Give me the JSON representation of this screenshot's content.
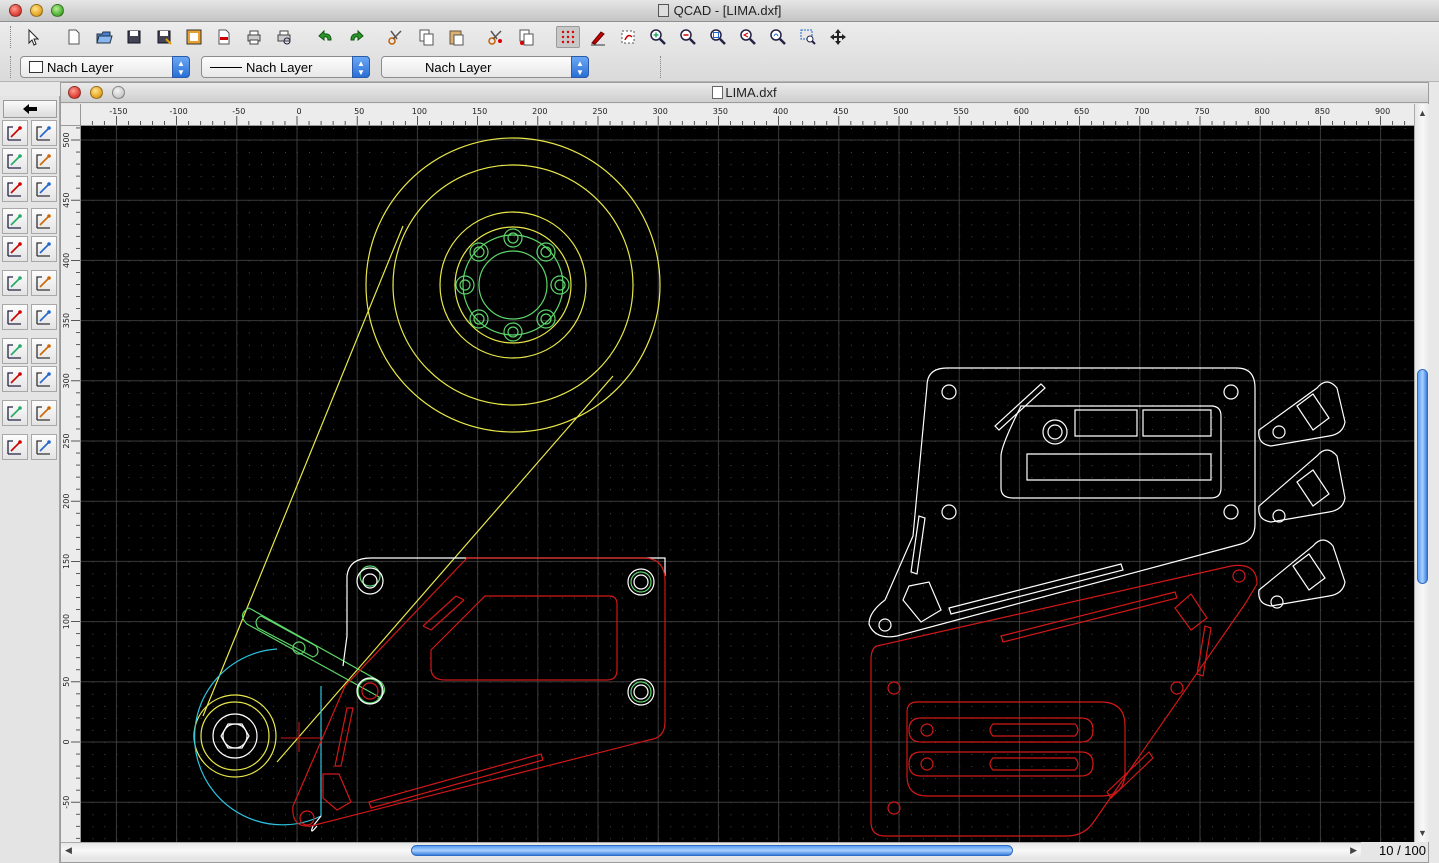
{
  "window": {
    "title": "QCAD - [LIMA.dxf]"
  },
  "toolbar": {
    "buttons": [
      {
        "name": "select-pointer-icon",
        "x": 22
      },
      {
        "name": "new-file-icon",
        "x": 62
      },
      {
        "name": "open-file-icon",
        "x": 92
      },
      {
        "name": "save-file-icon",
        "x": 122
      },
      {
        "name": "save-as-icon",
        "x": 152
      },
      {
        "name": "export-bitmap-icon",
        "x": 182
      },
      {
        "name": "export-pdf-icon",
        "x": 212
      },
      {
        "name": "print-icon",
        "x": 242
      },
      {
        "name": "print-preview-icon",
        "x": 272
      },
      {
        "name": "undo-icon",
        "x": 314
      },
      {
        "name": "redo-icon",
        "x": 344
      },
      {
        "name": "cut-icon",
        "x": 384
      },
      {
        "name": "copy-icon",
        "x": 414
      },
      {
        "name": "paste-icon",
        "x": 444
      },
      {
        "name": "cut-with-reference-icon",
        "x": 484
      },
      {
        "name": "copy-with-reference-icon",
        "x": 514
      },
      {
        "name": "toggle-grid-icon",
        "x": 556
      },
      {
        "name": "draft-mode-icon",
        "x": 586
      },
      {
        "name": "redraw-icon",
        "x": 616
      },
      {
        "name": "zoom-in-icon",
        "x": 646
      },
      {
        "name": "zoom-out-icon",
        "x": 676
      },
      {
        "name": "zoom-auto-icon",
        "x": 706
      },
      {
        "name": "zoom-previous-icon",
        "x": 736
      },
      {
        "name": "zoom-redraw-icon",
        "x": 766
      },
      {
        "name": "zoom-window-icon",
        "x": 796
      },
      {
        "name": "zoom-pan-icon",
        "x": 826
      }
    ],
    "color_combo": "Nach Layer",
    "width_combo": "Nach Layer",
    "linetype_combo": "Nach Layer"
  },
  "document": {
    "title": "LIMA.dxf",
    "page_counter": "10 / 100"
  },
  "rulers": {
    "x_ticks": [
      "-150",
      "-100",
      "-50",
      "0",
      "50",
      "100",
      "150",
      "200",
      "250",
      "300",
      "350",
      "400",
      "450",
      "500",
      "550",
      "600",
      "650",
      "700",
      "750",
      "800",
      "850",
      "900"
    ],
    "y_ticks": [
      "500",
      "450",
      "400",
      "350",
      "300",
      "250",
      "200",
      "150",
      "100",
      "50",
      "0",
      "-50"
    ]
  },
  "colors": {
    "canvas_bg": "#000000",
    "yellow": "#e8e84a",
    "green": "#5dd66a",
    "cyan": "#2cc4e0",
    "white": "#ffffff",
    "red": "#d21818",
    "grid_major": "#5a5a5a",
    "grid_dot": "#3c3c3c"
  }
}
